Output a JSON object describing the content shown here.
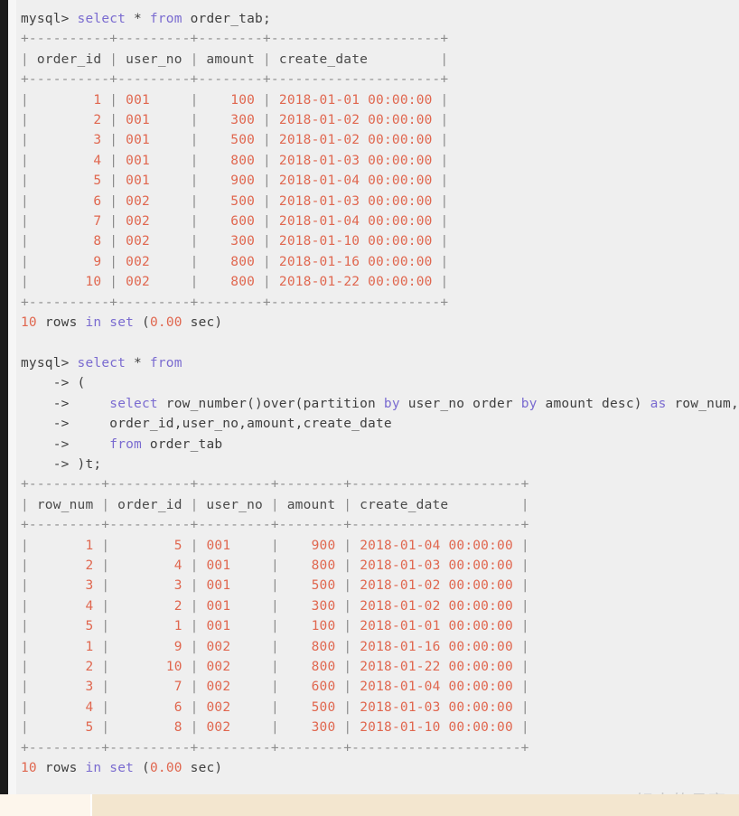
{
  "theme": {
    "console_background": "#efefef",
    "page_background": "#fdf3e4",
    "gutter_color": "#1b1b1b",
    "keyword_color": "#7a6bd0",
    "value_color": "#e0674f",
    "separator_color": "#8c8c8c",
    "text_color": "#4a4a4a",
    "watermark_color": "#c9c9c9"
  },
  "watermark": {
    "text": "CSDN @好大的月亮"
  },
  "session": {
    "prompt": "mysql>",
    "continuation_prompt": "->"
  },
  "block1": {
    "command": {
      "prompt": "mysql>",
      "keyword_select": "select",
      "star": " * ",
      "keyword_from": "from",
      "target": " order_tab;"
    },
    "rule": "+----------+---------+--------+---------------------+",
    "header": "| order_id | user_no | amount | create_date         |",
    "columns": [
      "order_id",
      "user_no",
      "amount",
      "create_date"
    ],
    "rows": [
      {
        "order_id": "1",
        "user_no": "001",
        "amount": "100",
        "create_date": "2018-01-01 00:00:00"
      },
      {
        "order_id": "2",
        "user_no": "001",
        "amount": "300",
        "create_date": "2018-01-02 00:00:00"
      },
      {
        "order_id": "3",
        "user_no": "001",
        "amount": "500",
        "create_date": "2018-01-02 00:00:00"
      },
      {
        "order_id": "4",
        "user_no": "001",
        "amount": "800",
        "create_date": "2018-01-03 00:00:00"
      },
      {
        "order_id": "5",
        "user_no": "001",
        "amount": "900",
        "create_date": "2018-01-04 00:00:00"
      },
      {
        "order_id": "6",
        "user_no": "002",
        "amount": "500",
        "create_date": "2018-01-03 00:00:00"
      },
      {
        "order_id": "7",
        "user_no": "002",
        "amount": "600",
        "create_date": "2018-01-04 00:00:00"
      },
      {
        "order_id": "8",
        "user_no": "002",
        "amount": "300",
        "create_date": "2018-01-10 00:00:00"
      },
      {
        "order_id": "9",
        "user_no": "002",
        "amount": "800",
        "create_date": "2018-01-16 00:00:00"
      },
      {
        "order_id": "10",
        "user_no": "002",
        "amount": "800",
        "create_date": "2018-01-22 00:00:00"
      }
    ],
    "status": {
      "count": "10",
      "rows_word": "rows",
      "in_word": "in",
      "set_word": "set",
      "open_paren": "(",
      "time": "0.00",
      "sec_word": "sec)"
    }
  },
  "block2": {
    "command_lines": [
      "mysql> select * from",
      "    -> (",
      "    ->     select row_number()over(partition by user_no order by amount desc) as row_num,",
      "    ->     order_id,user_no,amount,create_date",
      "    ->     from order_tab",
      "    -> )t;"
    ],
    "line1": {
      "prompt": "mysql>",
      "kw_select": "select",
      "star": " * ",
      "kw_from": "from"
    },
    "line2": {
      "arrow": "->",
      "text": "("
    },
    "line3": {
      "arrow": "->",
      "kw_select": "select",
      "fn": " row_number()over(partition ",
      "kw_by1": "by",
      "mid": " user_no order ",
      "kw_by2": "by",
      "tail": " amount desc) ",
      "kw_as": "as",
      "alias": " row_num,"
    },
    "line4": {
      "arrow": "->",
      "text": "order_id,user_no,amount,create_date"
    },
    "line5": {
      "arrow": "->",
      "kw_from": "from",
      "text": " order_tab"
    },
    "line6": {
      "arrow": "->",
      "text": ")t;"
    },
    "rule": "+---------+----------+---------+--------+---------------------+",
    "header": "| row_num | order_id | user_no | amount | create_date         |",
    "columns": [
      "row_num",
      "order_id",
      "user_no",
      "amount",
      "create_date"
    ],
    "rows": [
      {
        "row_num": "1",
        "order_id": "5",
        "user_no": "001",
        "amount": "900",
        "create_date": "2018-01-04 00:00:00"
      },
      {
        "row_num": "2",
        "order_id": "4",
        "user_no": "001",
        "amount": "800",
        "create_date": "2018-01-03 00:00:00"
      },
      {
        "row_num": "3",
        "order_id": "3",
        "user_no": "001",
        "amount": "500",
        "create_date": "2018-01-02 00:00:00"
      },
      {
        "row_num": "4",
        "order_id": "2",
        "user_no": "001",
        "amount": "300",
        "create_date": "2018-01-02 00:00:00"
      },
      {
        "row_num": "5",
        "order_id": "1",
        "user_no": "001",
        "amount": "100",
        "create_date": "2018-01-01 00:00:00"
      },
      {
        "row_num": "1",
        "order_id": "9",
        "user_no": "002",
        "amount": "800",
        "create_date": "2018-01-16 00:00:00"
      },
      {
        "row_num": "2",
        "order_id": "10",
        "user_no": "002",
        "amount": "800",
        "create_date": "2018-01-22 00:00:00"
      },
      {
        "row_num": "3",
        "order_id": "7",
        "user_no": "002",
        "amount": "600",
        "create_date": "2018-01-04 00:00:00"
      },
      {
        "row_num": "4",
        "order_id": "6",
        "user_no": "002",
        "amount": "500",
        "create_date": "2018-01-03 00:00:00"
      },
      {
        "row_num": "5",
        "order_id": "8",
        "user_no": "002",
        "amount": "300",
        "create_date": "2018-01-10 00:00:00"
      }
    ],
    "status": {
      "count": "10",
      "rows_word": "rows",
      "in_word": "in",
      "set_word": "set",
      "open_paren": "(",
      "time": "0.00",
      "sec_word": "sec)"
    }
  }
}
